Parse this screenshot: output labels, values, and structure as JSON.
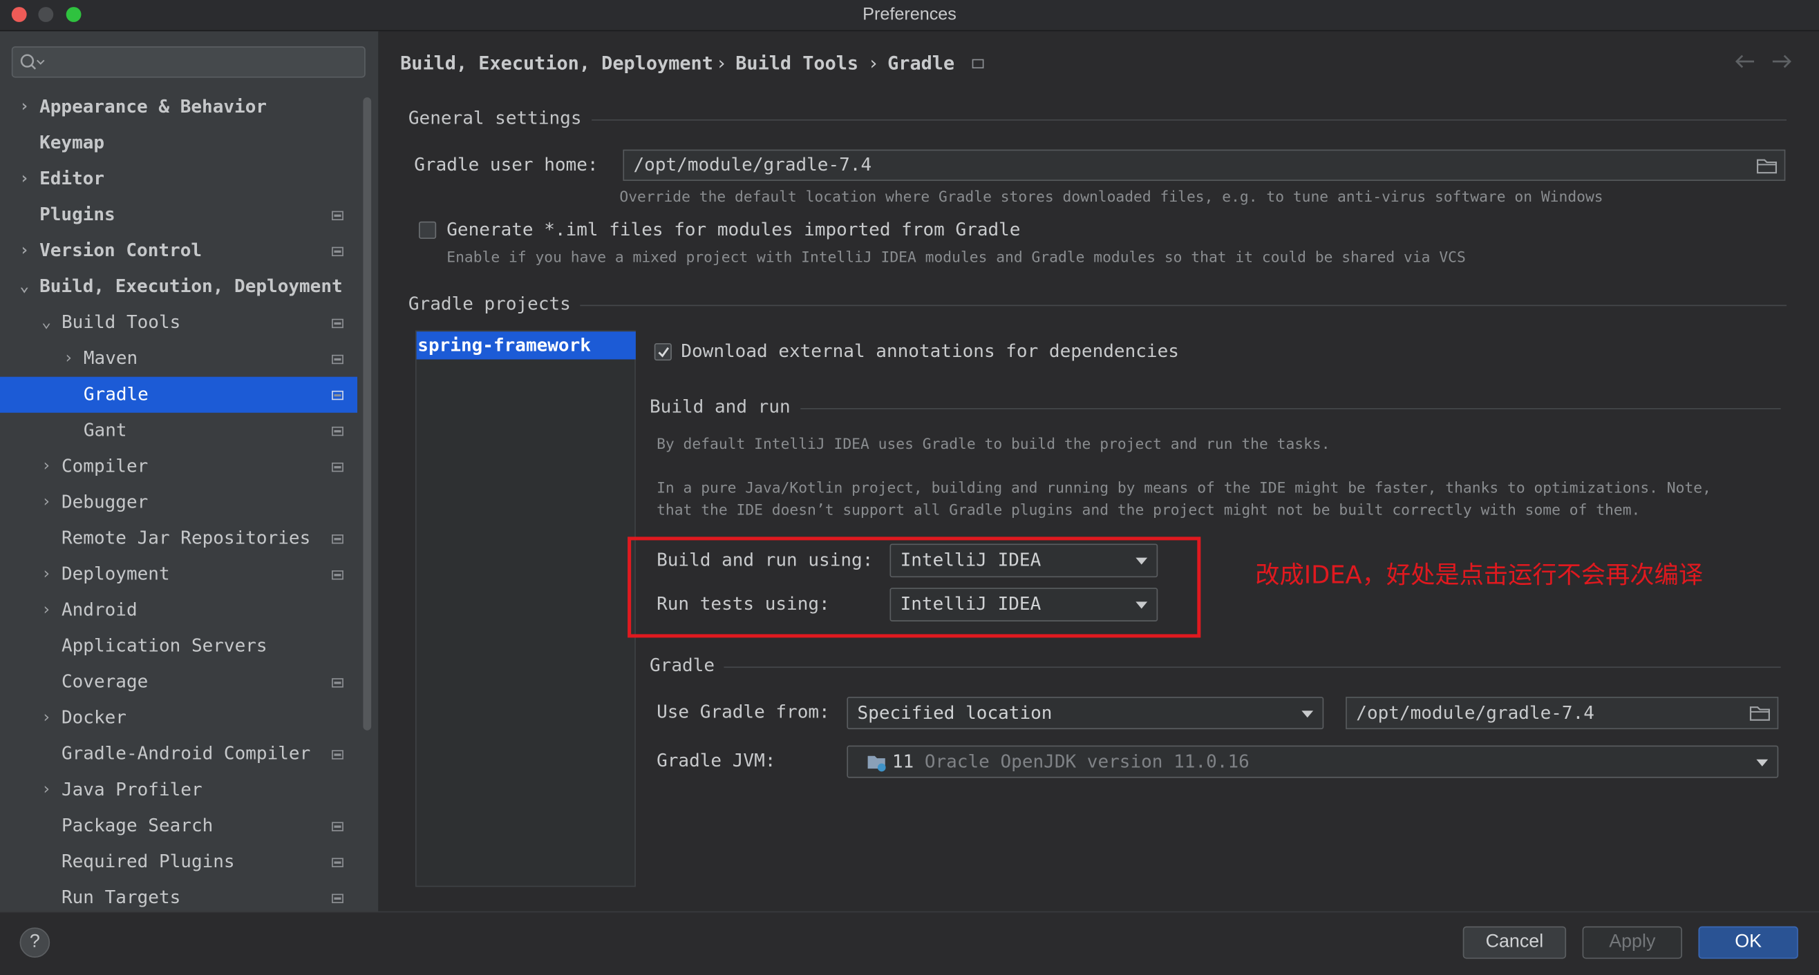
{
  "window": {
    "title": "Preferences"
  },
  "search": {
    "placeholder": ""
  },
  "sidebar": {
    "items": [
      {
        "label": "Appearance & Behavior",
        "bold": true,
        "arrow": "›",
        "level": 0,
        "page_icon": false
      },
      {
        "label": "Keymap",
        "bold": true,
        "arrow": "",
        "level": 0,
        "page_icon": false
      },
      {
        "label": "Editor",
        "bold": true,
        "arrow": "›",
        "level": 0,
        "page_icon": false
      },
      {
        "label": "Plugins",
        "bold": true,
        "arrow": "",
        "level": 0,
        "page_icon": true
      },
      {
        "label": "Version Control",
        "bold": true,
        "arrow": "›",
        "level": 0,
        "page_icon": true
      },
      {
        "label": "Build, Execution, Deployment",
        "bold": true,
        "arrow": "⌄",
        "level": 0,
        "page_icon": false
      },
      {
        "label": "Build Tools",
        "bold": false,
        "arrow": "⌄",
        "level": 1,
        "page_icon": true
      },
      {
        "label": "Maven",
        "bold": false,
        "arrow": "›",
        "level": 2,
        "page_icon": true
      },
      {
        "label": "Gradle",
        "bold": false,
        "arrow": "",
        "level": 2,
        "page_icon": true,
        "selected": true
      },
      {
        "label": "Gant",
        "bold": false,
        "arrow": "",
        "level": 2,
        "page_icon": true
      },
      {
        "label": "Compiler",
        "bold": false,
        "arrow": "›",
        "level": 1,
        "page_icon": true
      },
      {
        "label": "Debugger",
        "bold": false,
        "arrow": "›",
        "level": 1,
        "page_icon": false
      },
      {
        "label": "Remote Jar Repositories",
        "bold": false,
        "arrow": "",
        "level": 1,
        "page_icon": true
      },
      {
        "label": "Deployment",
        "bold": false,
        "arrow": "›",
        "level": 1,
        "page_icon": true
      },
      {
        "label": "Android",
        "bold": false,
        "arrow": "›",
        "level": 1,
        "page_icon": false
      },
      {
        "label": "Application Servers",
        "bold": false,
        "arrow": "",
        "level": 1,
        "page_icon": false
      },
      {
        "label": "Coverage",
        "bold": false,
        "arrow": "",
        "level": 1,
        "page_icon": true
      },
      {
        "label": "Docker",
        "bold": false,
        "arrow": "›",
        "level": 1,
        "page_icon": false
      },
      {
        "label": "Gradle-Android Compiler",
        "bold": false,
        "arrow": "",
        "level": 1,
        "page_icon": true
      },
      {
        "label": "Java Profiler",
        "bold": false,
        "arrow": "›",
        "level": 1,
        "page_icon": false
      },
      {
        "label": "Package Search",
        "bold": false,
        "arrow": "",
        "level": 1,
        "page_icon": true
      },
      {
        "label": "Required Plugins",
        "bold": false,
        "arrow": "",
        "level": 1,
        "page_icon": true
      },
      {
        "label": "Run Targets",
        "bold": false,
        "arrow": "",
        "level": 1,
        "page_icon": true
      }
    ]
  },
  "breadcrumb": {
    "part1": "Build, Execution, Deployment",
    "part2": "Build Tools",
    "part3": "Gradle",
    "sep": "›"
  },
  "general": {
    "title": "General settings",
    "user_home_label": "Gradle user home:",
    "user_home_value": "/opt/module/gradle-7.4",
    "user_home_hint": "Override the default location where Gradle stores downloaded files, e.g. to tune anti-virus software on Windows",
    "iml_label": "Generate *.iml files for modules imported from Gradle",
    "iml_checked": false,
    "iml_hint": "Enable if you have a mixed project with IntelliJ IDEA modules and Gradle modules so that it could be shared via VCS"
  },
  "projects": {
    "title": "Gradle projects",
    "list": [
      "spring-framework"
    ],
    "download_annotations_label": "Download external annotations for dependencies",
    "download_annotations_checked": true
  },
  "build_and_run": {
    "title": "Build and run",
    "desc1": "By default IntelliJ IDEA uses Gradle to build the project and run the tasks.",
    "desc2": "In a pure Java/Kotlin project, building and running by means of the IDE might be faster, thanks to optimizations. Note,",
    "desc3": "that the IDE doesn’t support all Gradle plugins and the project might not be built correctly with some of them.",
    "build_label": "Build and run using:",
    "build_value": "IntelliJ IDEA",
    "tests_label": "Run tests using:",
    "tests_value": "IntelliJ IDEA"
  },
  "annotation": {
    "text": "改成IDEA，好处是点击运行不会再次编译",
    "color": "#e0191f"
  },
  "gradle": {
    "title": "Gradle",
    "use_from_label": "Use Gradle from:",
    "use_from_value": "Specified location",
    "location_value": "/opt/module/gradle-7.4",
    "jvm_label": "Gradle JVM:",
    "jvm_version": "11",
    "jvm_desc": "Oracle OpenJDK version 11.0.16"
  },
  "footer": {
    "help": "?",
    "cancel": "Cancel",
    "apply": "Apply",
    "ok": "OK"
  },
  "colors": {
    "selection": "#1c5bd6",
    "accent_button": "#2a5394",
    "highlight_box": "#e0191f"
  }
}
